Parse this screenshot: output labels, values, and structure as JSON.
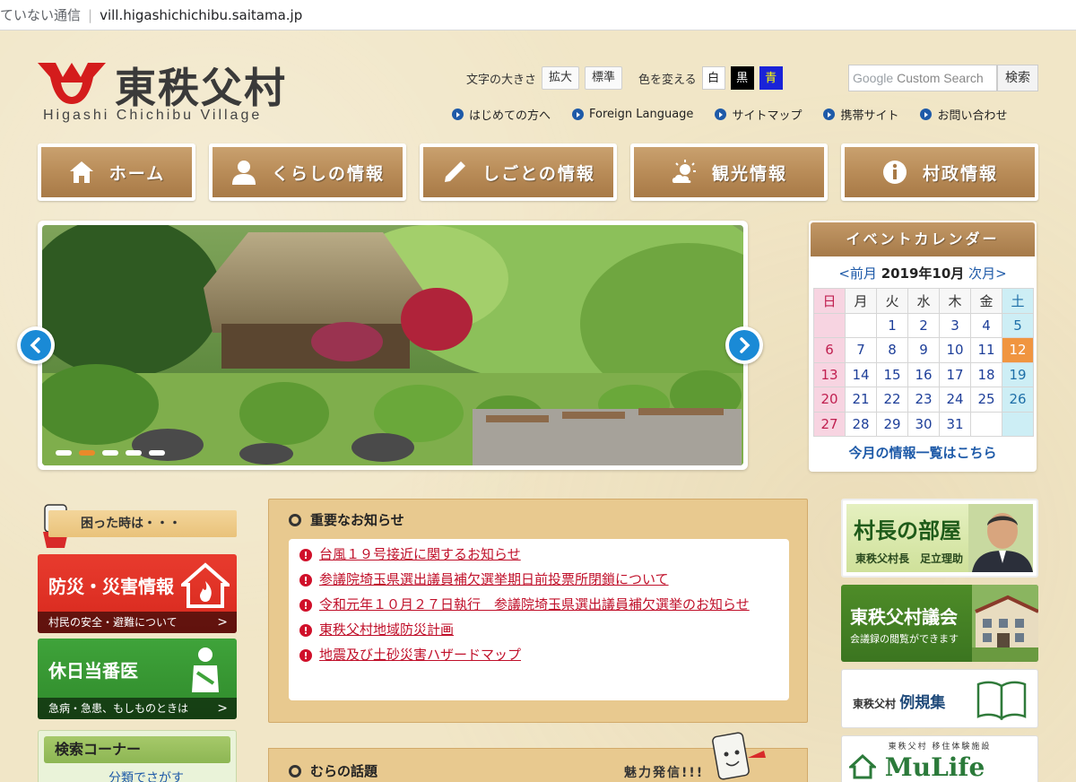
{
  "browser": {
    "security_text": "ていない通信",
    "url": "vill.higashichichibu.saitama.jp"
  },
  "header": {
    "title": "東秩父村",
    "subtitle": "Higashi Chichibu Village",
    "font_size_label": "文字の大きさ",
    "enlarge_label": "拡大",
    "standard_label": "標準",
    "color_label": "色を変える",
    "color_white": "白",
    "color_black": "黒",
    "color_blue": "青",
    "search_google": "Google",
    "search_placeholder": "Custom Search",
    "search_button": "検索",
    "brand_red": "#d41c1c"
  },
  "top_links": [
    {
      "label": "はじめての方へ"
    },
    {
      "label": "Foreign Language"
    },
    {
      "label": "サイトマップ"
    },
    {
      "label": "携帯サイト"
    },
    {
      "label": "お問い合わせ"
    }
  ],
  "nav": [
    {
      "label": "ホーム",
      "icon": "house-icon"
    },
    {
      "label": "くらしの情報",
      "icon": "person-icon"
    },
    {
      "label": "しごとの情報",
      "icon": "pencil-icon"
    },
    {
      "label": "観光情報",
      "icon": "sun-cloud-icon"
    },
    {
      "label": "村政情報",
      "icon": "info-icon"
    }
  ],
  "slider": {
    "dot_count": 5,
    "active_dot": 2
  },
  "calendar": {
    "heading": "イベントカレンダー",
    "prev": "<前月",
    "current": "2019年10月",
    "next": "次月>",
    "weekdays": [
      "日",
      "月",
      "火",
      "水",
      "木",
      "金",
      "土"
    ],
    "weeks": [
      [
        "",
        "",
        "1",
        "2",
        "3",
        "4",
        "5"
      ],
      [
        "6",
        "7",
        "8",
        "9",
        "10",
        "11",
        "12"
      ],
      [
        "13",
        "14",
        "15",
        "16",
        "17",
        "18",
        "19"
      ],
      [
        "20",
        "21",
        "22",
        "23",
        "24",
        "25",
        "26"
      ],
      [
        "27",
        "28",
        "29",
        "30",
        "31",
        "",
        ""
      ]
    ],
    "today": "12",
    "more_link": "今月の情報一覧はこちら"
  },
  "left": {
    "komatta": "困った時は・・・",
    "bosai_title": "防災・災害情報",
    "bosai_sub": "村民の安全・避難について",
    "kyujitsu_title": "休日当番医",
    "kyujitsu_sub": "急病・急患、もしものときは",
    "kensaku_title": "検索コーナー",
    "kensaku_sub": "分類でさがす"
  },
  "news": {
    "title": "重要なお知らせ",
    "items": [
      "台風１９号接近に関するお知らせ",
      "参議院埼玉県選出議員補欠選挙期日前投票所閉鎖について",
      "令和元年１０月２７日執行　参議院埼玉県選出議員補欠選挙のお知らせ",
      "東秩父村地域防災計画",
      "地震及び土砂災害ハザードマップ"
    ]
  },
  "mura": {
    "title": "むらの話題",
    "tagline": "魅力発信!!!"
  },
  "right": {
    "soncho_title": "村長の部屋",
    "soncho_sub": "東秩父村長　足立理助",
    "gikai_title": "東秩父村議会",
    "gikai_sub": "会議録の閲覧ができます",
    "reiki_prefix": "東秩父村",
    "reiki_title": "例規集",
    "mulife_caption": "東秩父村 移住体験施設",
    "mulife_logo": "MuLife"
  }
}
